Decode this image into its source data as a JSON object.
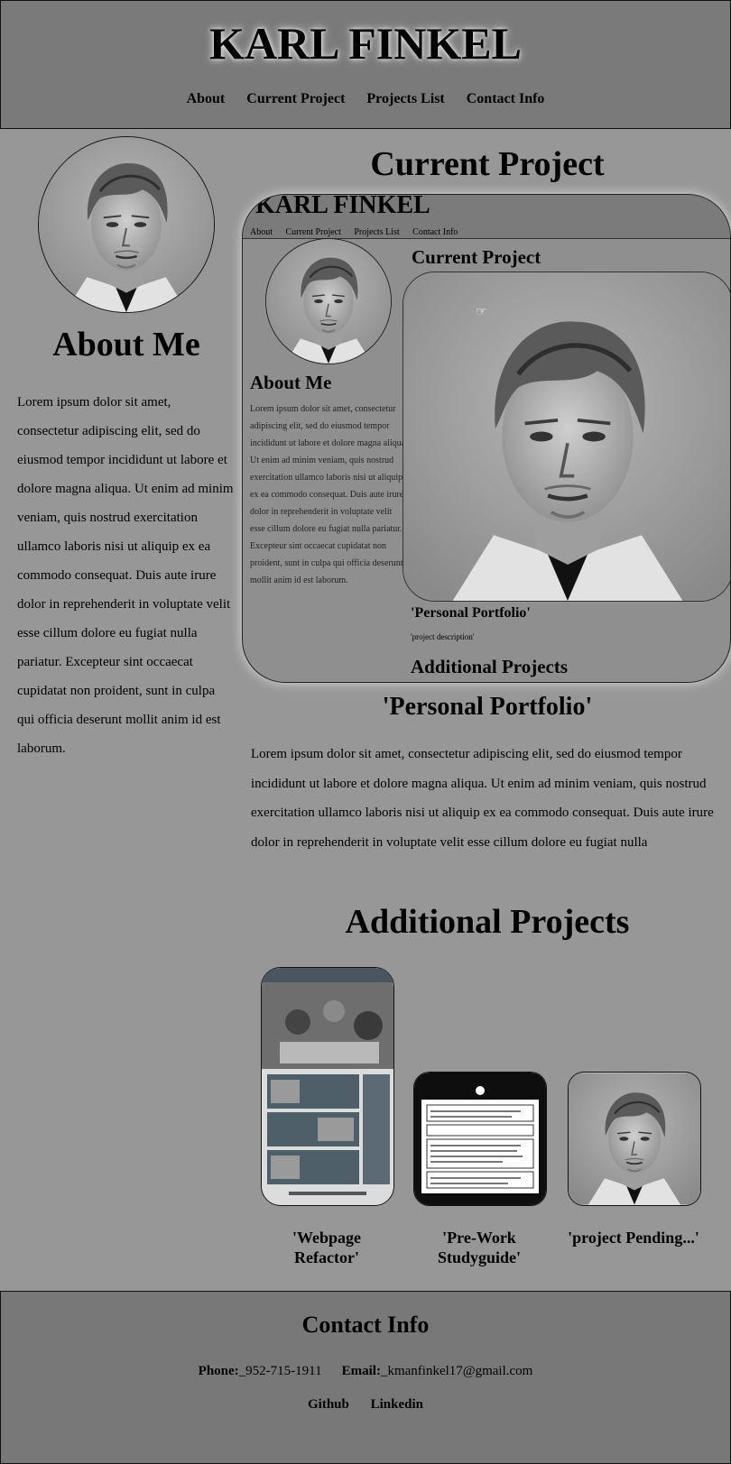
{
  "header": {
    "title": "KARL FINKEL",
    "nav": [
      "About",
      "Current Project",
      "Projects List",
      "Contact Info"
    ]
  },
  "sidebar": {
    "avatar": "portrait-photo",
    "about_heading": "About Me",
    "about_text": "Lorem ipsum dolor sit amet, consectetur adipiscing elit, sed do eiusmod tempor incididunt ut labore et dolore magna aliqua. Ut enim ad minim veniam, quis nostrud exercitation ullamco laboris nisi ut aliquip ex ea commodo consequat. Duis aute irure dolor in reprehenderit in voluptate velit esse cillum dolore eu fugiat nulla pariatur. Excepteur sint occaecat cupidatat non proident, sunt in culpa qui officia deserunt mollit anim id est laborum."
  },
  "main": {
    "current_heading": "Current Project",
    "preview": {
      "title": "KARL FINKEL",
      "nav": [
        "About",
        "Current Project",
        "Projects List",
        "Contact Info"
      ],
      "about_heading": "About Me",
      "about_text": "Lorem ipsum dolor sit amet, consectetur adipiscing elit, sed do eiusmod tempor incididunt ut labore et dolore magna aliqua. Ut enim ad minim veniam, quis nostrud exercitation ullamco laboris nisi ut aliquip ex ea commodo consequat. Duis aute irure dolor in reprehenderit in voluptate velit esse cillum dolore eu fugiat nulla pariatur. Excepteur sint occaecat cupidatat non proident, sunt in culpa qui officia deserunt mollit anim id est laborum.",
      "current_heading": "Current Project",
      "project_title": "'Personal Portfolio'",
      "project_description": "'project description'",
      "additional_heading": "Additional Projects"
    },
    "project_title": "'Personal Portfolio'",
    "project_text": "Lorem ipsum dolor sit amet, consectetur adipiscing elit, sed do eiusmod tempor incididunt ut labore et dolore magna aliqua. Ut enim ad minim veniam, quis nostrud exercitation ullamco laboris nisi ut aliquip ex ea commodo consequat. Duis aute irure dolor in reprehenderit in voluptate velit esse cillum dolore eu fugiat nulla",
    "additional_heading": "Additional Projects",
    "projects": [
      {
        "label": "'Webpage Refactor'"
      },
      {
        "label": "'Pre-Work Studyguide'"
      },
      {
        "label": "'project Pending...'"
      }
    ]
  },
  "footer": {
    "heading": "Contact Info",
    "phone_label": "Phone:",
    "phone": "_952-715-1911",
    "email_label": "Email:",
    "email": "_kmanfinkel17@gmail.com",
    "links": [
      "Github",
      "Linkedin"
    ]
  }
}
